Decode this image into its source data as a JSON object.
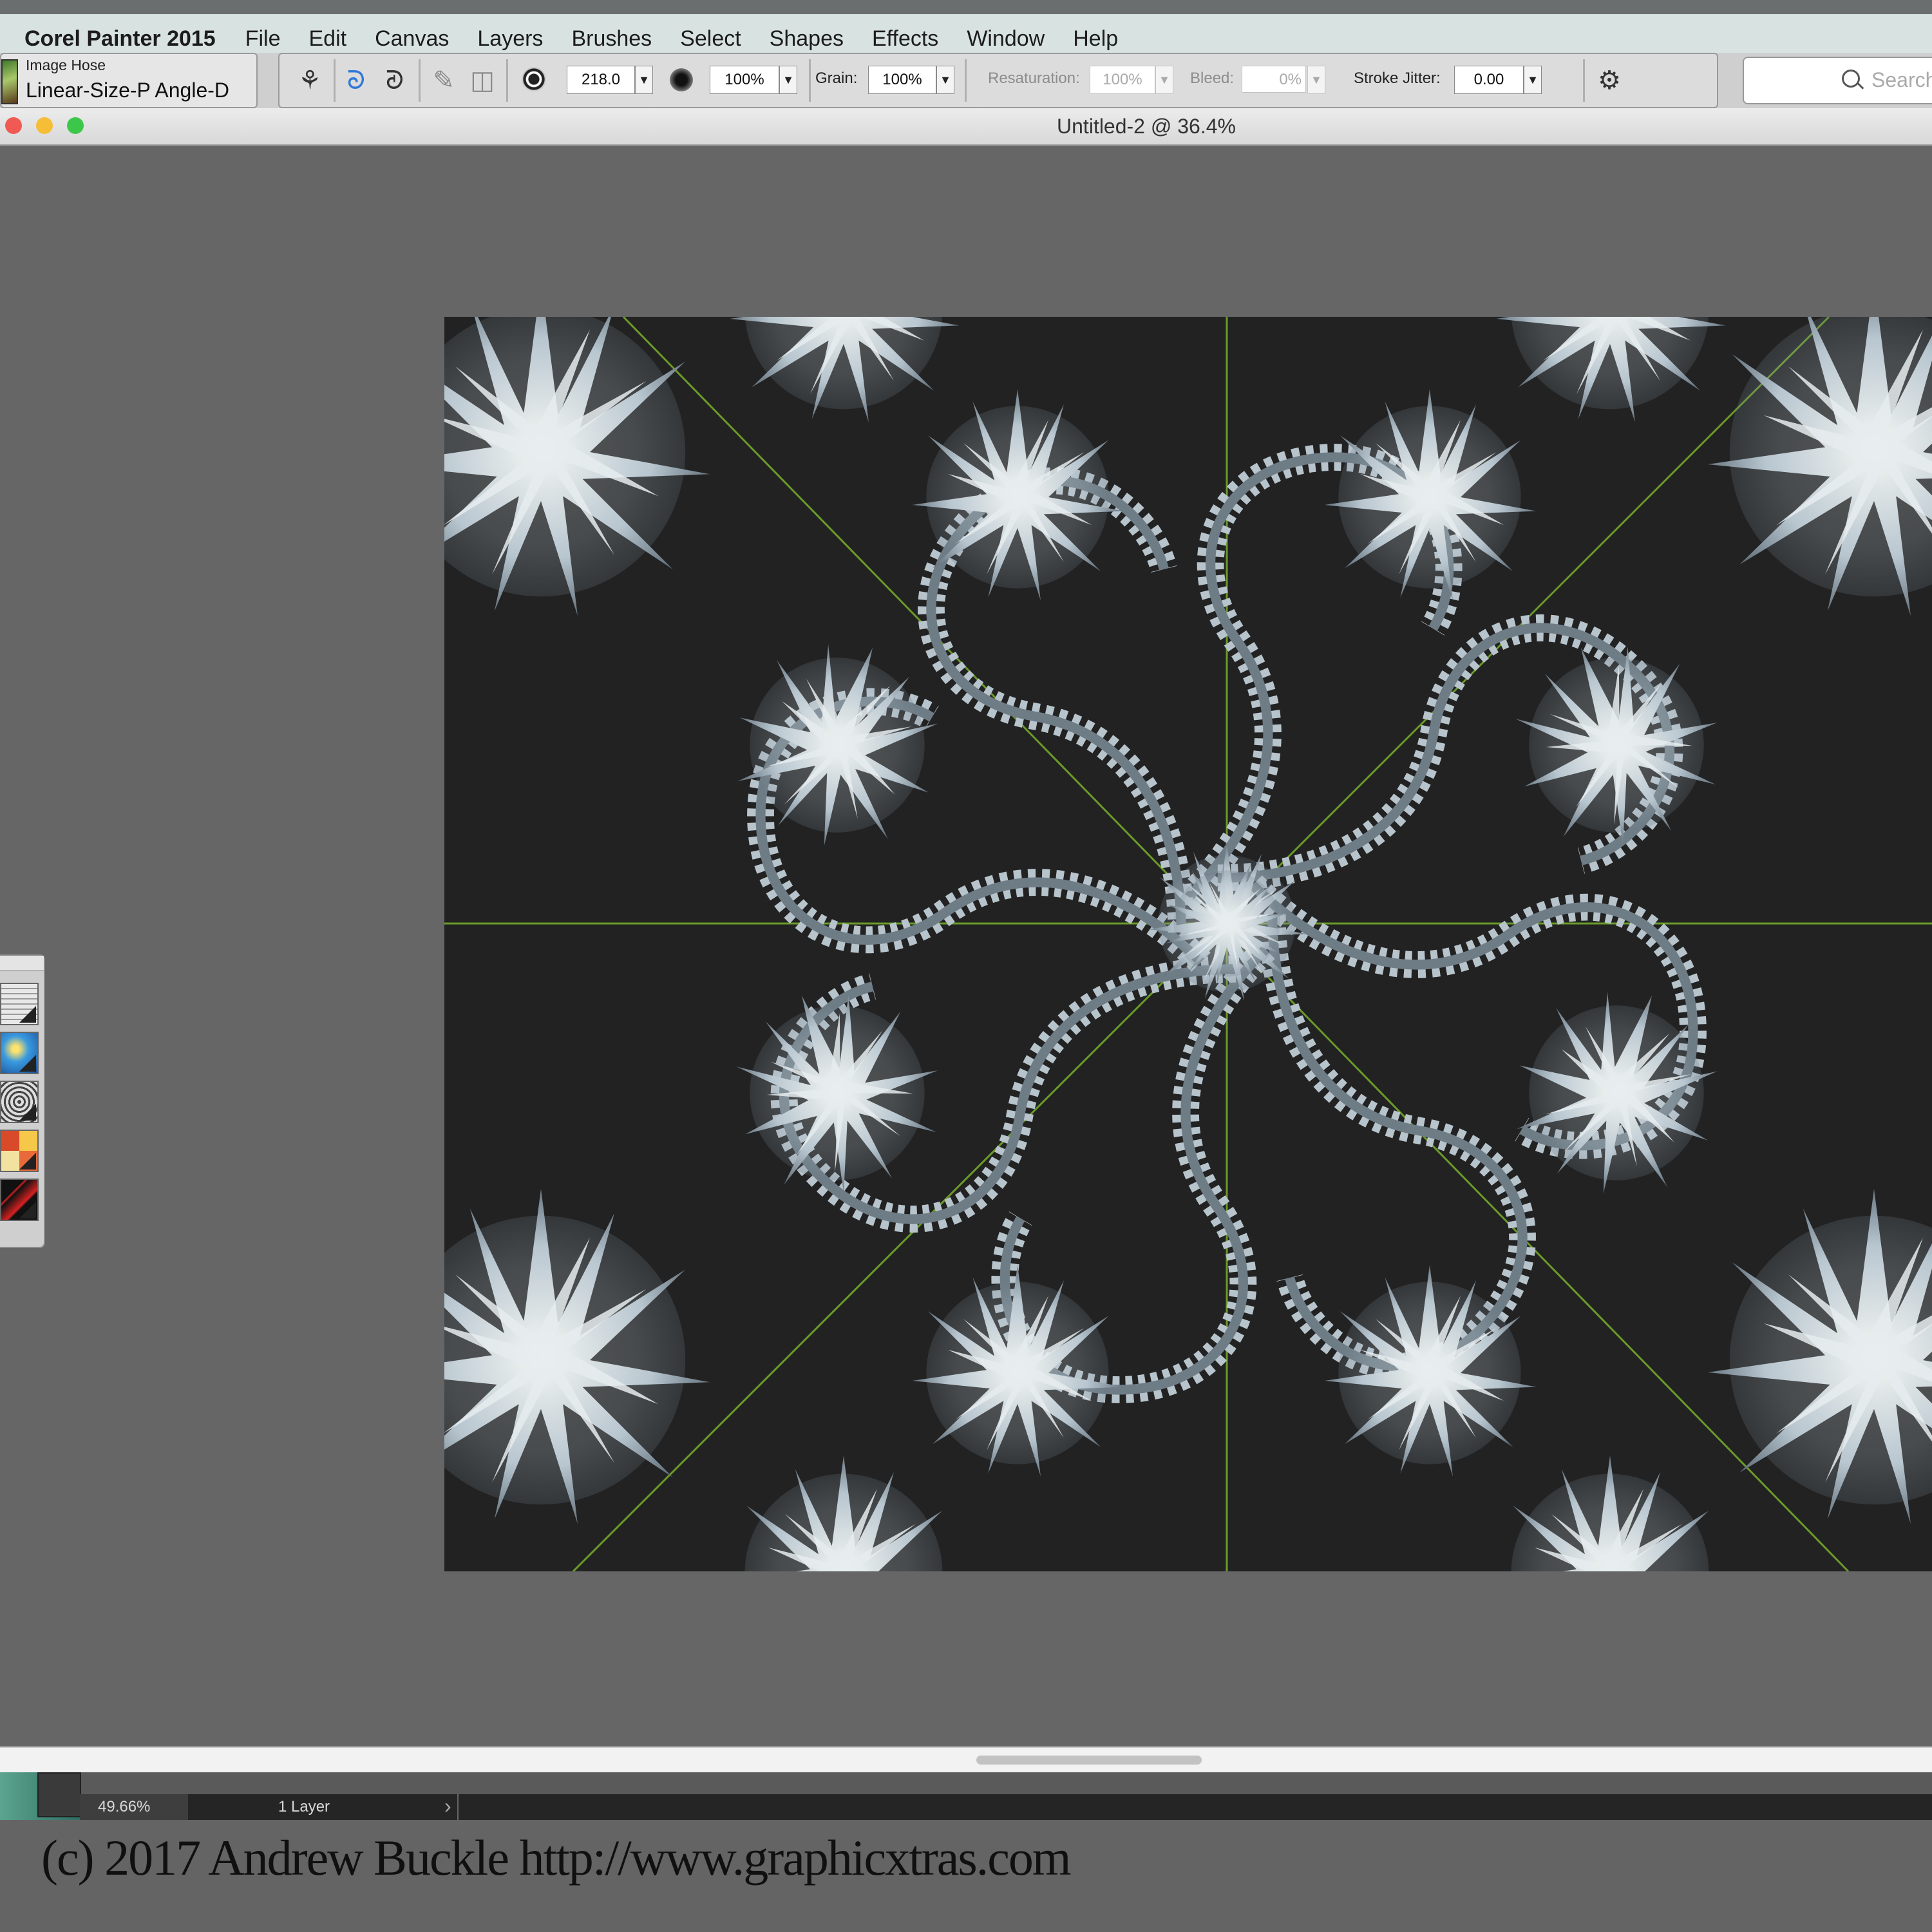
{
  "menubar": {
    "app_name": "Corel Painter 2015",
    "items": [
      "File",
      "Edit",
      "Canvas",
      "Layers",
      "Brushes",
      "Select",
      "Shapes",
      "Effects",
      "Window",
      "Help"
    ]
  },
  "property_bar": {
    "brush_category": "Image Hose",
    "brush_variant": "Linear-Size-P Angle-D",
    "size_value": "218.0",
    "opacity_value": "100%",
    "grain_label": "Grain:",
    "grain_value": "100%",
    "resaturation_label": "Resaturation:",
    "resaturation_value": "100%",
    "bleed_label": "Bleed:",
    "bleed_value": "0%",
    "stroke_jitter_label": "Stroke Jitter:",
    "stroke_jitter_value": "0.00",
    "search_placeholder": "Search"
  },
  "document": {
    "title": "Untitled-2 @ 36.4%"
  },
  "status_bar": {
    "zoom": "49.66%",
    "layers": "1 Layer"
  },
  "footer": {
    "copyright": "(c) 2017 Andrew Buckle http://www.graphicxtras.com"
  },
  "colors": {
    "canvas_background": "#222222",
    "symmetry_guides": "#6a9a2a",
    "hose_spikes": "#c8d4dc",
    "accent_blue": "#2f7ad8"
  },
  "icons": {
    "brush_selector": "brush-thumbnail-icon",
    "reset_tool": "reset-tool-icon",
    "freehand_stroke": "freehand-stroke-icon",
    "straight_line_stroke": "straight-line-stroke-icon",
    "search": "search-icon"
  }
}
